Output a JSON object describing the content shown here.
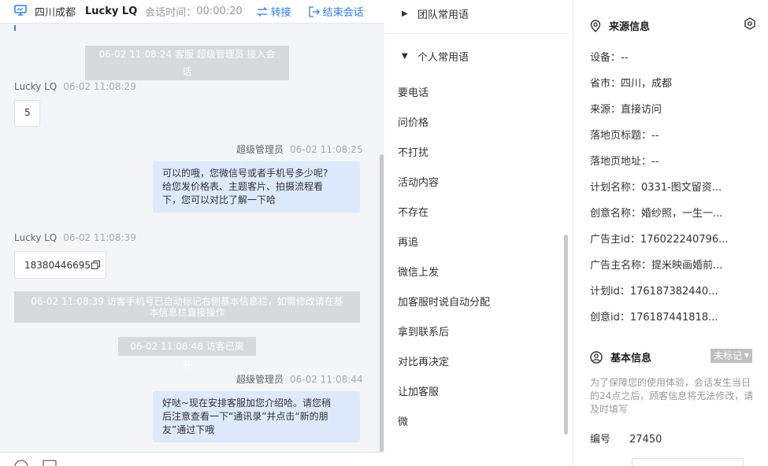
{
  "header": {
    "location": "四川成都",
    "visitor_name": "Lucky LQ",
    "timer_label": "会话时间：",
    "timer_value": "00:00:20",
    "transfer_label": "转接",
    "end_label": "结束会话"
  },
  "messages": {
    "sys1": "06-02 11:08:24 客服 超级管理员 接入会话",
    "m1_sender": "Lucky LQ",
    "m1_time": "06-02 11:08:29",
    "m1_text": "5",
    "m2_sender": "超级管理员",
    "m2_time": "06-02 11:08:25",
    "m2_line1": "可以的哦，您微信号或者手机号多少呢?",
    "m2_line2": "给您发价格表、主题客片、拍摄流程看",
    "m2_line3": "下，您可以对比了解一下哈",
    "m3_sender": "Lucky LQ",
    "m3_time": "06-02 11:08:39",
    "m3_text": "18380446695",
    "sys2_line1": "06-02 11:08:39 访客手机号已自动标记右侧基本信息栏，如需修改请在基",
    "sys2_line2": "本信息栏直接操作",
    "sys3": "06-02 11:08:48 访客已离开",
    "m4_sender": "超级管理员",
    "m4_time": "06-02 11:08:44",
    "m4_line1": "好哒~现在安排客服加您介绍哈。请您稍",
    "m4_line2": "后注意查看一下“通讯录”并点击“新的朋",
    "m4_line3": "友”通过下哦"
  },
  "phrases": {
    "team_group": "团队常用语",
    "personal_group": "个人常用语",
    "items": [
      "要电话",
      "问价格",
      "不打扰",
      "活动内容",
      "不存在",
      "再追",
      "微信上发",
      "加客服时说自动分配",
      "拿到联系后",
      "对比再决定",
      "让加客服",
      "微"
    ]
  },
  "source": {
    "title": "来源信息",
    "device": "设备：--",
    "province": "省市：四川，成都",
    "origin": "来源：直接访问",
    "landing_title": "落地页标题：--",
    "landing_url": "落地页地址：--",
    "plan_name": "计划名称：0331-图文留资...",
    "creative_name": "创意名称：婚纱照，一生一...",
    "advertiser_id": "广告主id：176022240796...",
    "advertiser_name": "广告主名称：提米映画婚前...",
    "plan_id": "计划id：176187382440...",
    "creative_id": "创意id：176187441818..."
  },
  "basic": {
    "title": "基本信息",
    "tag": "未标记",
    "note": "为了保障您的使用体验，会话发生当日的24点之后，顾客信息将无法修改，请及时填写",
    "number_label": "编号",
    "number_value": "27450"
  },
  "colors": {
    "accent": "#2e7cf6",
    "bubble_right": "#dde9fd",
    "system_pill": "#d8d9dc"
  }
}
